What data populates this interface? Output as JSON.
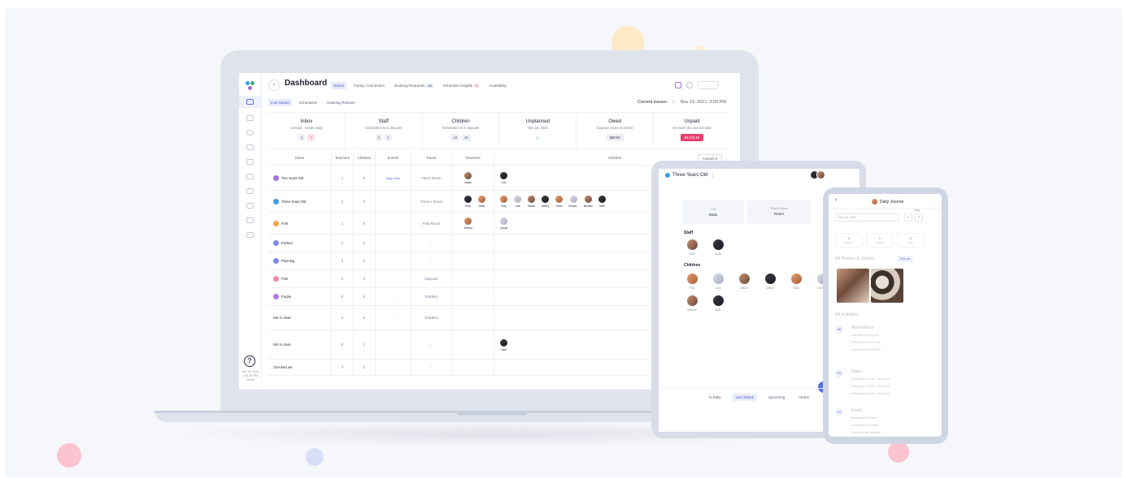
{
  "colors": {
    "accent": "#5b6fe0",
    "success": "#3ab07a",
    "danger": "#e63e6d",
    "blob_yellow": "#fde9c4",
    "blob_pink": "#fcc3d1",
    "blob_blue": "#d9def9"
  },
  "laptop": {
    "title": "Dashboard",
    "subtitle": "-",
    "tabs": [
      {
        "label": "Status"
      },
      {
        "label": "Family Connection"
      },
      {
        "label": "Booking Requests",
        "badge": "26"
      },
      {
        "label": "Schedule Insights",
        "badge": "3"
      },
      {
        "label": "Availability"
      }
    ],
    "subtabs": [
      "Live Status",
      "Scheduled",
      "Awaiting Release"
    ],
    "issues_label": "Current issues:",
    "issues_date": "Nov 19, 2021, 3:50 PM",
    "summary": [
      {
        "title": "Inbox",
        "sub": "Unread · needs reply",
        "vals": [
          "5",
          "2"
        ]
      },
      {
        "title": "Staff",
        "sub": "Scheduled vs in daycare",
        "vals": [
          "5",
          "4"
        ]
      },
      {
        "title": "Children",
        "sub": "Scheduled vs in daycare",
        "vals": [
          "18",
          "10"
        ]
      },
      {
        "title": "Unplanned",
        "sub": "Nov 19, 2021",
        "vals": [
          "✓"
        ]
      },
      {
        "title": "Owed",
        "sub": "Daycare owes to clients",
        "vals": [
          "$20.60"
        ]
      },
      {
        "title": "Unpaid",
        "sub": "Services due but not paid",
        "vals": [
          "$5,218.60"
        ]
      }
    ],
    "columns": [
      "Class",
      "Teachers",
      "Children",
      "Events",
      "Room",
      "Teachers",
      "Children"
    ],
    "actions_label": "Actions ▾",
    "rows": [
      {
        "name": "Two Years Old",
        "color": "#a66fdc",
        "teachers": "1",
        "children": "0",
        "events": "Align time",
        "room": "Two's Room",
        "staff": [
          "Jessie"
        ],
        "kids": [
          "Loki"
        ]
      },
      {
        "name": "Three Years Old",
        "color": "#3a9ee6",
        "teachers": "2",
        "children": "0",
        "events": "-",
        "room": "Three's Room",
        "staff": [
          "Kelly",
          "Dean"
        ],
        "kids": [
          "Fitzy",
          "Luke",
          "Nikola",
          "Jeffery",
          "Fabio",
          "Christo...",
          "Michael",
          "Matt"
        ]
      },
      {
        "name": "Fork",
        "color": "#f0a44b",
        "teachers": "1",
        "children": "0",
        "events": "",
        "room": "Pink Room",
        "staff": [
          "Jemma"
        ],
        "kids": [
          "Carola"
        ]
      },
      {
        "name": "Kitchen",
        "color": "#7b8ae8",
        "teachers": "0",
        "children": "0",
        "events": "-",
        "room": "-",
        "staff": [],
        "kids": []
      },
      {
        "name": "Planning",
        "color": "#7b8ae8",
        "teachers": "0",
        "children": "0",
        "events": "-",
        "room": "-",
        "staff": [],
        "kids": []
      },
      {
        "name": "Pink",
        "color": "#f28aa6",
        "teachers": "0",
        "children": "0",
        "events": "-",
        "room": "Daycare",
        "staff": [],
        "kids": []
      },
      {
        "name": "Purple",
        "color": "#b27be0",
        "teachers": "0",
        "children": "0",
        "events": "-",
        "room": "Toddlers",
        "staff": [],
        "kids": []
      },
      {
        "name": "Not in class",
        "color": "",
        "teachers": "0",
        "children": "0",
        "events": "-",
        "room": "Toddlers",
        "staff": [],
        "kids": []
      },
      {
        "name": "Not in class",
        "color": "",
        "teachers": "0",
        "children": "1",
        "events": "-",
        "room": "-",
        "staff": [],
        "kids": [
          "Dale"
        ]
      },
      {
        "name": "Checked out",
        "color": "",
        "teachers": "0",
        "children": "0",
        "events": "-",
        "room": "-",
        "staff": [],
        "kids": []
      }
    ],
    "footer_date": "Nov 19, 2021",
    "footer_time": "1:51:02 PM",
    "footer_name": "Tamra"
  },
  "tablet": {
    "title": "Three Years Old",
    "box_left_value": "2·0",
    "box_left_label": "Ratio",
    "box_right_value": "Three's Room",
    "box_right_label": "Room",
    "staff_label": "Staff",
    "staff": [
      "Kelly",
      "Dean"
    ],
    "children_label": "Children",
    "children": [
      "Fitzy",
      "Luke",
      "Nikola",
      "Jeffery",
      "Fabio",
      "Christo",
      "Michael",
      "Matt"
    ],
    "tabs": [
      "N Daily",
      "Live Status",
      "Upcoming",
      "Notes"
    ]
  },
  "phone": {
    "title": "Daily Journal",
    "search_placeholder": "Nov 19, 2021",
    "today_label": "Today",
    "stats": [
      {
        "value": "2",
        "label": "Activities"
      },
      {
        "value": "1",
        "label": "Photos"
      },
      {
        "value": "0",
        "label": "Likes"
      }
    ],
    "photos_label": "All Photos & Videos",
    "see_all": "See all",
    "activities_label": "All activities",
    "activities": [
      {
        "icon": "Att",
        "title": "Attendance",
        "lines": [
          "Checked in 8:51 am",
          "Checked out 3:17 pm",
          "Checked out by Mom"
        ]
      },
      {
        "icon": "Ns",
        "title": "Naps",
        "lines": [
          "Sleeping 9:10 am - 9:51 pm",
          "Sleeping 1:15 pm - 2:10 pm",
          "Sleeping 4:15 pm - 4:45 pm"
        ]
      },
      {
        "icon": "Fd",
        "title": "Food",
        "lines": [
          "Breakfast 9:00 am",
          "Lunch all rice, meat",
          "Snack some, banana"
        ]
      }
    ]
  }
}
